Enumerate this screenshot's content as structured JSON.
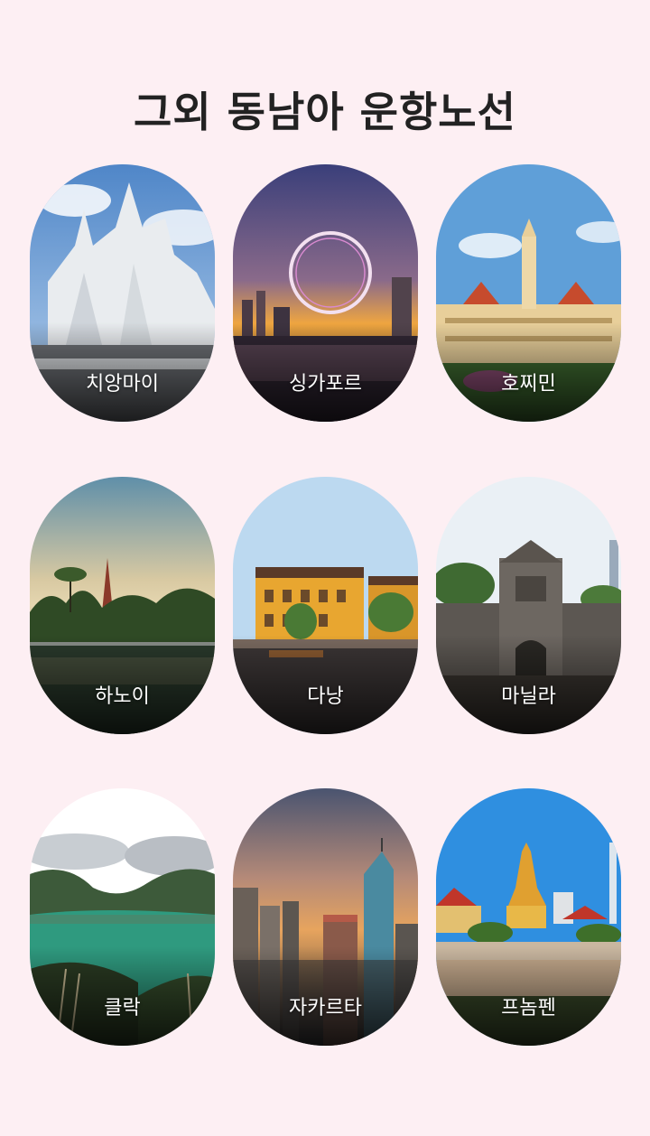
{
  "page": {
    "title": "그외 동남아 운항노선"
  },
  "routes": [
    {
      "label": "치앙마이",
      "image": "white-temple-photo"
    },
    {
      "label": "싱가포르",
      "image": "singapore-flyer-skyline-photo"
    },
    {
      "label": "호찌민",
      "image": "city-hall-photo"
    },
    {
      "label": "하노이",
      "image": "pagoda-lake-photo"
    },
    {
      "label": "다낭",
      "image": "old-town-river-photo"
    },
    {
      "label": "마닐라",
      "image": "fort-gate-photo"
    },
    {
      "label": "클락",
      "image": "crater-lake-photo"
    },
    {
      "label": "자카르타",
      "image": "city-skyline-sunset-photo"
    },
    {
      "label": "프놈펜",
      "image": "royal-palace-photo"
    }
  ],
  "colors": {
    "background": "#fdeff3",
    "title": "#222222",
    "label": "#ffffff"
  }
}
